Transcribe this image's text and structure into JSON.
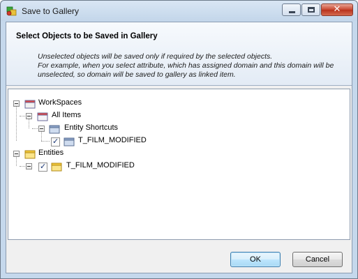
{
  "window": {
    "title": "Save to Gallery"
  },
  "header": {
    "title": "Select Objects to be Saved in Gallery",
    "description_lines": [
      "Unselected objects will be saved only if required by the selected objects.",
      "For example, when you select attribute, which has assigned domain and this domain will be",
      "unselected, so domain will be saved to gallery as linked item."
    ]
  },
  "tree": {
    "workspaces": {
      "label": "WorkSpaces",
      "expanded": true
    },
    "all_items": {
      "label": "All Items",
      "expanded": true
    },
    "entity_shortcuts": {
      "label": "Entity Shortcuts",
      "expanded": true
    },
    "shortcut_item": {
      "label": "T_FILM_MODIFIED",
      "checked": true
    },
    "entities": {
      "label": "Entities",
      "expanded": true
    },
    "entity_item": {
      "label": "T_FILM_MODIFIED",
      "checked": true
    }
  },
  "buttons": {
    "ok": "OK",
    "cancel": "Cancel"
  },
  "caption": {
    "close_glyph": "✕"
  }
}
